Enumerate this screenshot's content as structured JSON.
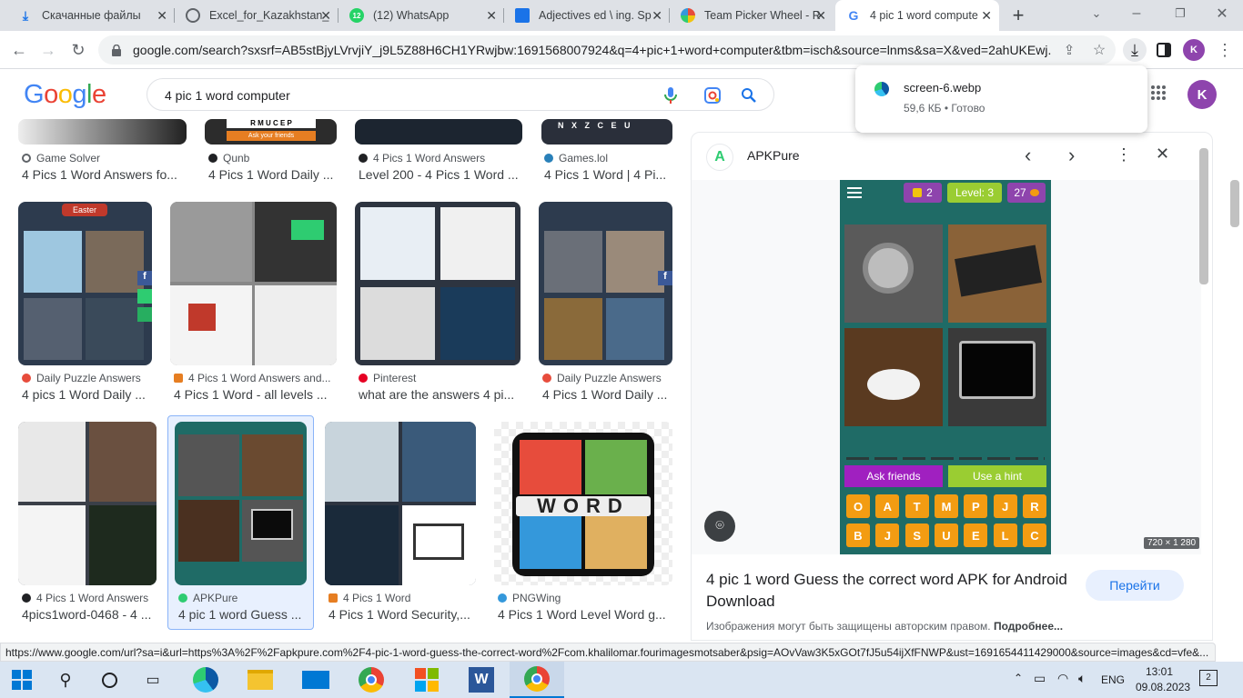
{
  "tabs": [
    {
      "title": "Скачанные файлы",
      "icon": "download-icon"
    },
    {
      "title": "Excel_for_Kazakhstan_",
      "icon": "globe-icon"
    },
    {
      "title": "(12) WhatsApp",
      "icon": "whatsapp-icon",
      "badge": "12"
    },
    {
      "title": "Adjectives ed \\ ing. Sp",
      "icon": "grid-icon"
    },
    {
      "title": "Team Picker Wheel - R",
      "icon": "wheel-icon"
    },
    {
      "title": "4 pic 1 word compute",
      "icon": "google-icon"
    }
  ],
  "toolbar": {
    "url": "google.com/search?sxsrf=AB5stBjyLVrvjiY_j9L5Z88H6CH1YRwjbw:1691568007924&q=4+pic+1+word+computer&tbm=isch&source=lnms&sa=X&ved=2ahUKEwj...",
    "profile_initial": "K"
  },
  "google": {
    "logo": "Google",
    "query": "4 pic 1 word computer",
    "avatar": "K"
  },
  "rows": [
    [
      {
        "source": "Game Solver",
        "title": "4 Pics 1 Word Answers fo..."
      },
      {
        "source": "Qunb",
        "title": "4 Pics 1 Word Daily ..."
      },
      {
        "source": "4 Pics 1 Word Answers",
        "title": "Level 200 - 4 Pics 1 Word ..."
      },
      {
        "source": "Games.lol",
        "title": "4 Pics 1 Word | 4 Pi..."
      }
    ],
    [
      {
        "source": "Daily Puzzle Answers",
        "title": "4 pics 1 Word Daily ..."
      },
      {
        "source": "4 Pics 1 Word Answers and...",
        "title": "4 Pics 1 Word - all levels ..."
      },
      {
        "source": "Pinterest",
        "title": "what are the answers 4 pi..."
      },
      {
        "source": "Daily Puzzle Answers",
        "title": "4 Pics 1 Word Daily ..."
      }
    ],
    [
      {
        "source": "4 Pics 1 Word Answers",
        "title": "4pics1word-0468 - 4 ..."
      },
      {
        "source": "APKPure",
        "title": "4 pic 1 word Guess ..."
      },
      {
        "source": "4 Pics 1 Word",
        "title": "4 Pics 1 Word Security,..."
      },
      {
        "source": "PNGWing",
        "title": "4 Pics 1 Word Level Word g..."
      }
    ]
  ],
  "row1_thumbs": {
    "qunb_strip": "R M U C E P",
    "qunb_button": "Ask your friends",
    "easter": "Easter",
    "games_tiles": "N X Z C E U"
  },
  "word_logo": "WORD",
  "panel": {
    "source": "APKPure",
    "game": {
      "coins_left": "2",
      "level": "Level: 3",
      "coins": "27",
      "ask": "Ask friends",
      "hint": "Use a hint",
      "letters_row1": [
        "O",
        "A",
        "T",
        "M",
        "P",
        "J",
        "R"
      ],
      "letters_row2": [
        "B",
        "J",
        "S",
        "U",
        "E",
        "L",
        "C"
      ]
    },
    "dims": "720 × 1 280",
    "title": "4 pic 1 word Guess the correct word APK for Android Download",
    "visit": "Перейти",
    "notice": "Изображения могут быть защищены авторским правом.",
    "more": "Подробнее..."
  },
  "download": {
    "filename": "screen-6.webp",
    "meta": "59,6 КБ • Готово"
  },
  "status_url": "https://www.google.com/url?sa=i&url=https%3A%2F%2Fapkpure.com%2F4-pic-1-word-guess-the-correct-word%2Fcom.khalilomar.fourimagesmotsaber&psig=AOvVaw3K5xGOt7fJ5u54ijXfFNWP&ust=1691654411429000&source=images&cd=vfe&...",
  "taskbar": {
    "lang": "ENG",
    "time": "13:01",
    "date": "09.08.2023",
    "notif": "2"
  },
  "colors": {
    "accent": "#1a73e8",
    "teal": "#1f7a73",
    "purple": "#8e44ad",
    "lime": "#9acd32",
    "orange": "#f39c12"
  }
}
